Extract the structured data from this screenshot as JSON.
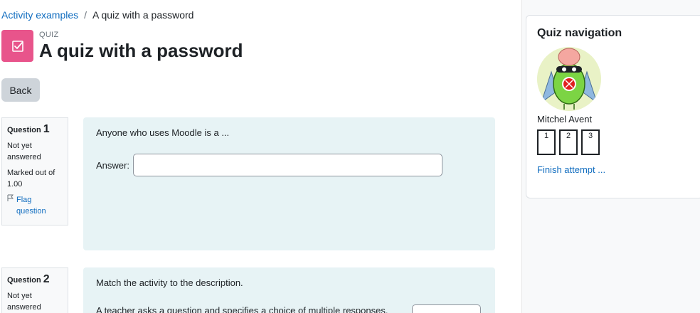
{
  "breadcrumb": {
    "parent": "Activity examples",
    "separator": "/",
    "current": "A quiz with a password"
  },
  "header": {
    "pretitle": "QUIZ",
    "title": "A quiz with a password",
    "icon": "quiz-checkbox-icon",
    "icon_color": "#e8548b"
  },
  "back_label": "Back",
  "questions": [
    {
      "label": "Question",
      "number": "1",
      "state": "Not yet answered",
      "grade": "Marked out of 1.00",
      "flag": "Flag\nquestion",
      "text": "Anyone who uses Moodle is a ...",
      "answer_label": "Answer:",
      "answer_value": ""
    },
    {
      "label": "Question",
      "number": "2",
      "state": "Not yet answered",
      "text": "Match the activity to the description.",
      "match_prompt": "A teacher asks a question and specifies a choice of multiple responses."
    }
  ],
  "quiz_nav": {
    "title": "Quiz navigation",
    "user_name": "Mitchel Avent",
    "question_buttons": [
      "1",
      "2",
      "3"
    ],
    "finish_label": "Finish attempt ..."
  },
  "colors": {
    "link": "#0f6cbf",
    "question_bg": "#e7f3f5",
    "button_bg": "#ced4da"
  }
}
